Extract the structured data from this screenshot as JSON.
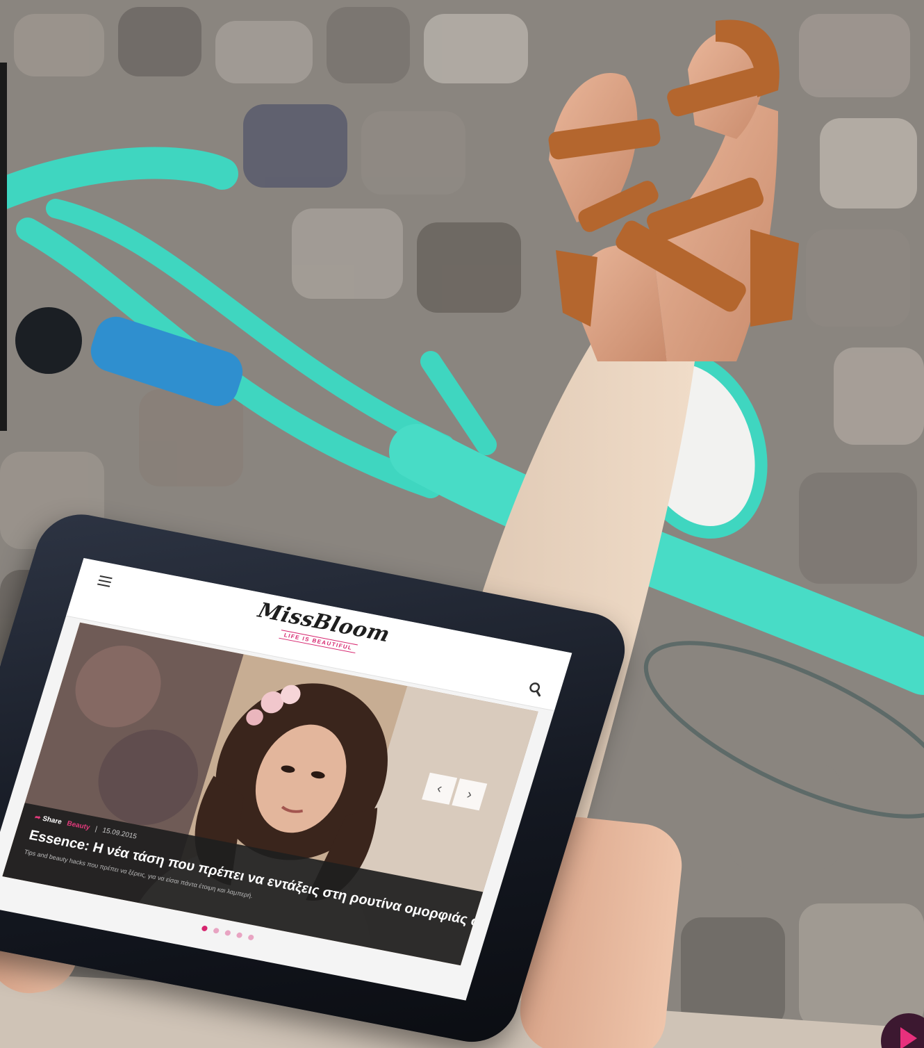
{
  "site": {
    "logo_title": "MissBloom",
    "logo_tagline": "LIFE IS BEAUTIFUL"
  },
  "slider": {
    "prev_label": "‹",
    "next_label": "›",
    "slides_total": 5,
    "active_slide": 1
  },
  "article": {
    "share_label": "Share",
    "category": "Beauty",
    "date": "15.09.2015",
    "title": "Essence: Η νέα τάση που πρέπει να εντάξεις στη ρουτίνα ομορφιάς σου",
    "excerpt": "Tips and beauty hacks που πρέπει να ξέρεις, για να είσαι πάντα έτοιμη και λαμπερή."
  },
  "colors": {
    "accent": "#d6246e",
    "bike_teal": "#3fd6c0",
    "sandal_brown": "#b4662e"
  }
}
